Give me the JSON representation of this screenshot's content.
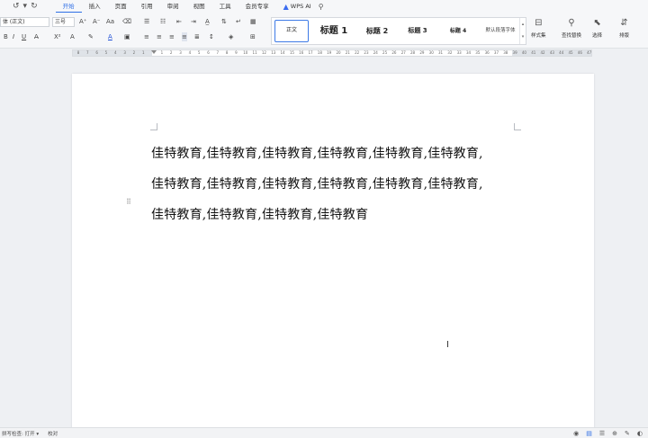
{
  "quick_access": {
    "undo_icon": "↺",
    "dropdown_icon": "▾",
    "redo_icon": "↻"
  },
  "menu": {
    "items": [
      "开始",
      "插入",
      "页面",
      "引用",
      "审阅",
      "视图",
      "工具",
      "会员专享"
    ],
    "active_index": 0,
    "wps_ai": "WPS AI",
    "search_icon": "⚲"
  },
  "ribbon": {
    "font_name": "体 (正文)",
    "font_size": "三号",
    "styles": [
      "正文",
      "标题 1",
      "标题 2",
      "标题 3",
      "标题 4",
      "默认段落字体"
    ],
    "selected_style_index": 0,
    "buttons": {
      "style_set": "样式集",
      "find_replace": "查找替换",
      "select": "选择",
      "sort": "排版"
    },
    "colors": {
      "accent": "#2f6fe6",
      "style_border": "#3d7ae6"
    }
  },
  "ruler": {
    "numbers": [
      "8",
      "7",
      "6",
      "5",
      "4",
      "3",
      "2",
      "1",
      "",
      "1",
      "2",
      "3",
      "4",
      "5",
      "6",
      "7",
      "8",
      "9",
      "10",
      "11",
      "12",
      "13",
      "14",
      "15",
      "16",
      "17",
      "18",
      "19",
      "20",
      "21",
      "22",
      "23",
      "24",
      "25",
      "26",
      "27",
      "28",
      "29",
      "30",
      "31",
      "32",
      "33",
      "34",
      "35",
      "36",
      "37",
      "38",
      "39",
      "40",
      "41",
      "42",
      "43",
      "44",
      "45",
      "46",
      "47"
    ]
  },
  "document": {
    "lines": [
      "佳特教育,佳特教育,佳特教育,佳特教育,佳特教育,佳特教育,",
      "佳特教育,佳特教育,佳特教育,佳特教育,佳特教育,佳特教育,",
      "佳特教育,佳特教育,佳特教育,佳特教育"
    ]
  },
  "status": {
    "spell_check": "拼写检查: 打开 ▾",
    "proofread": "校对"
  }
}
